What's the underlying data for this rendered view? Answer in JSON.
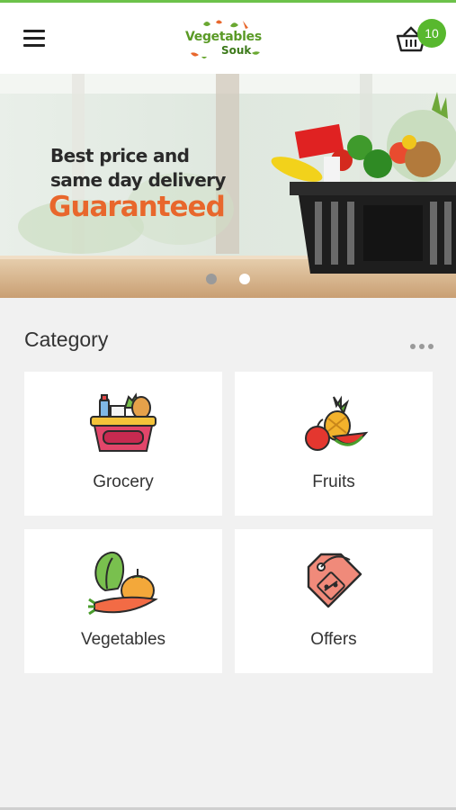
{
  "app": {
    "logo_line1": "Vegetables",
    "logo_line2": "Souk",
    "cart_count": "10",
    "accent_color": "#58b82e"
  },
  "banner": {
    "line1": "Best price and",
    "line2": "same day delivery",
    "line3": "Guaranteed",
    "slides": 2,
    "active_slide": 1
  },
  "category": {
    "title": "Category",
    "items": [
      {
        "label": "Grocery",
        "icon": "grocery-basket-icon"
      },
      {
        "label": "Fruits",
        "icon": "fruits-icon"
      },
      {
        "label": "Vegetables",
        "icon": "vegetables-icon"
      },
      {
        "label": "Offers",
        "icon": "offer-tag-icon"
      }
    ]
  }
}
